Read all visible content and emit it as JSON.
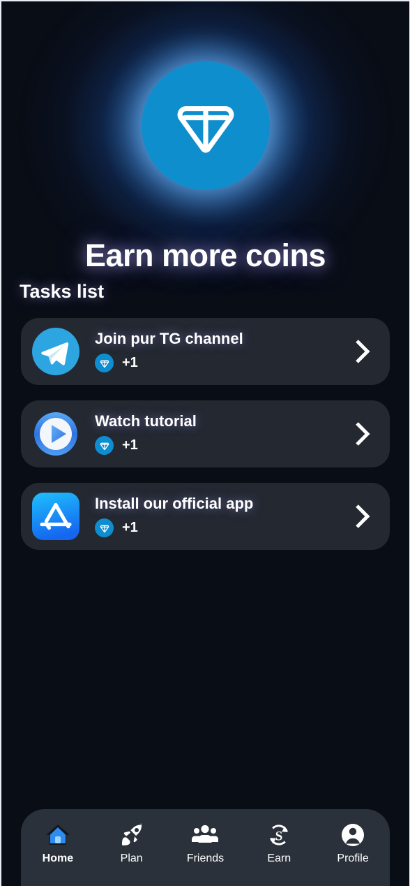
{
  "theme": {
    "page_background": "#090D16",
    "card_background": "#232831",
    "navbar_background": "#2B313B",
    "accent_blue": "#0E8ED0",
    "telegram_blue": "#2CA5E0",
    "text_primary": "#FFFFFF",
    "glow_color": "#A9A3F0"
  },
  "hero": {
    "coin_icon": "ton-diamond-icon",
    "title": "Earn more coins"
  },
  "tasks_section": {
    "heading": "Tasks list",
    "items": [
      {
        "label": "Join pur TG channel",
        "icon": "telegram-icon",
        "reward_badge_icon": "ton-diamond-icon",
        "reward": "+1",
        "chevron": "chevron-right-icon"
      },
      {
        "label": "Watch tutorial",
        "icon": "play-circle-icon",
        "reward_badge_icon": "ton-diamond-icon",
        "reward": "+1",
        "chevron": "chevron-right-icon"
      },
      {
        "label": "Install our official app",
        "icon": "app-store-icon",
        "reward_badge_icon": "ton-diamond-icon",
        "reward": "+1",
        "chevron": "chevron-right-icon"
      }
    ]
  },
  "bottom_nav": {
    "items": [
      {
        "label": "Home",
        "icon": "home-icon",
        "active": true
      },
      {
        "label": "Plan",
        "icon": "rocket-icon",
        "active": false
      },
      {
        "label": "Friends",
        "icon": "people-group-icon",
        "active": false
      },
      {
        "label": "Earn",
        "icon": "currency-exchange-icon",
        "active": false
      },
      {
        "label": "Profile",
        "icon": "person-circle-icon",
        "active": false
      }
    ]
  }
}
